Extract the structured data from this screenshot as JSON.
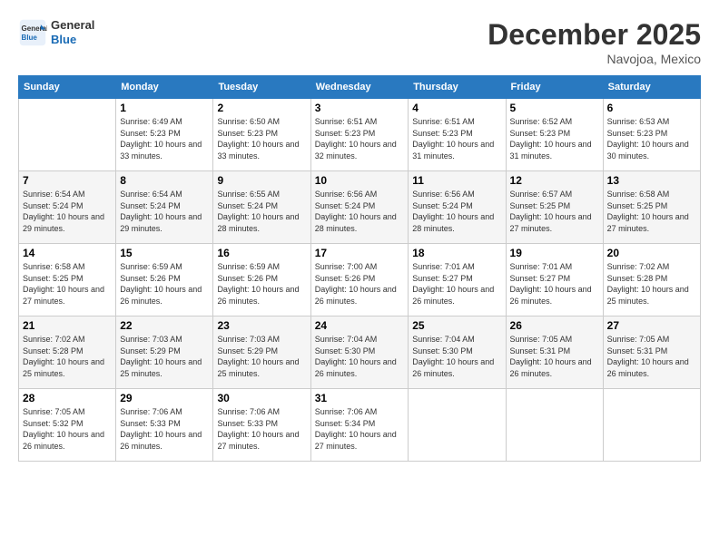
{
  "header": {
    "logo_line1": "General",
    "logo_line2": "Blue",
    "month": "December 2025",
    "location": "Navojoa, Mexico"
  },
  "days_of_week": [
    "Sunday",
    "Monday",
    "Tuesday",
    "Wednesday",
    "Thursday",
    "Friday",
    "Saturday"
  ],
  "weeks": [
    [
      {
        "day": "",
        "info": ""
      },
      {
        "day": "1",
        "info": "Sunrise: 6:49 AM\nSunset: 5:23 PM\nDaylight: 10 hours\nand 33 minutes."
      },
      {
        "day": "2",
        "info": "Sunrise: 6:50 AM\nSunset: 5:23 PM\nDaylight: 10 hours\nand 33 minutes."
      },
      {
        "day": "3",
        "info": "Sunrise: 6:51 AM\nSunset: 5:23 PM\nDaylight: 10 hours\nand 32 minutes."
      },
      {
        "day": "4",
        "info": "Sunrise: 6:51 AM\nSunset: 5:23 PM\nDaylight: 10 hours\nand 31 minutes."
      },
      {
        "day": "5",
        "info": "Sunrise: 6:52 AM\nSunset: 5:23 PM\nDaylight: 10 hours\nand 31 minutes."
      },
      {
        "day": "6",
        "info": "Sunrise: 6:53 AM\nSunset: 5:23 PM\nDaylight: 10 hours\nand 30 minutes."
      }
    ],
    [
      {
        "day": "7",
        "info": "Sunrise: 6:54 AM\nSunset: 5:24 PM\nDaylight: 10 hours\nand 29 minutes."
      },
      {
        "day": "8",
        "info": "Sunrise: 6:54 AM\nSunset: 5:24 PM\nDaylight: 10 hours\nand 29 minutes."
      },
      {
        "day": "9",
        "info": "Sunrise: 6:55 AM\nSunset: 5:24 PM\nDaylight: 10 hours\nand 28 minutes."
      },
      {
        "day": "10",
        "info": "Sunrise: 6:56 AM\nSunset: 5:24 PM\nDaylight: 10 hours\nand 28 minutes."
      },
      {
        "day": "11",
        "info": "Sunrise: 6:56 AM\nSunset: 5:24 PM\nDaylight: 10 hours\nand 28 minutes."
      },
      {
        "day": "12",
        "info": "Sunrise: 6:57 AM\nSunset: 5:25 PM\nDaylight: 10 hours\nand 27 minutes."
      },
      {
        "day": "13",
        "info": "Sunrise: 6:58 AM\nSunset: 5:25 PM\nDaylight: 10 hours\nand 27 minutes."
      }
    ],
    [
      {
        "day": "14",
        "info": "Sunrise: 6:58 AM\nSunset: 5:25 PM\nDaylight: 10 hours\nand 27 minutes."
      },
      {
        "day": "15",
        "info": "Sunrise: 6:59 AM\nSunset: 5:26 PM\nDaylight: 10 hours\nand 26 minutes."
      },
      {
        "day": "16",
        "info": "Sunrise: 6:59 AM\nSunset: 5:26 PM\nDaylight: 10 hours\nand 26 minutes."
      },
      {
        "day": "17",
        "info": "Sunrise: 7:00 AM\nSunset: 5:26 PM\nDaylight: 10 hours\nand 26 minutes."
      },
      {
        "day": "18",
        "info": "Sunrise: 7:01 AM\nSunset: 5:27 PM\nDaylight: 10 hours\nand 26 minutes."
      },
      {
        "day": "19",
        "info": "Sunrise: 7:01 AM\nSunset: 5:27 PM\nDaylight: 10 hours\nand 26 minutes."
      },
      {
        "day": "20",
        "info": "Sunrise: 7:02 AM\nSunset: 5:28 PM\nDaylight: 10 hours\nand 25 minutes."
      }
    ],
    [
      {
        "day": "21",
        "info": "Sunrise: 7:02 AM\nSunset: 5:28 PM\nDaylight: 10 hours\nand 25 minutes."
      },
      {
        "day": "22",
        "info": "Sunrise: 7:03 AM\nSunset: 5:29 PM\nDaylight: 10 hours\nand 25 minutes."
      },
      {
        "day": "23",
        "info": "Sunrise: 7:03 AM\nSunset: 5:29 PM\nDaylight: 10 hours\nand 25 minutes."
      },
      {
        "day": "24",
        "info": "Sunrise: 7:04 AM\nSunset: 5:30 PM\nDaylight: 10 hours\nand 26 minutes."
      },
      {
        "day": "25",
        "info": "Sunrise: 7:04 AM\nSunset: 5:30 PM\nDaylight: 10 hours\nand 26 minutes."
      },
      {
        "day": "26",
        "info": "Sunrise: 7:05 AM\nSunset: 5:31 PM\nDaylight: 10 hours\nand 26 minutes."
      },
      {
        "day": "27",
        "info": "Sunrise: 7:05 AM\nSunset: 5:31 PM\nDaylight: 10 hours\nand 26 minutes."
      }
    ],
    [
      {
        "day": "28",
        "info": "Sunrise: 7:05 AM\nSunset: 5:32 PM\nDaylight: 10 hours\nand 26 minutes."
      },
      {
        "day": "29",
        "info": "Sunrise: 7:06 AM\nSunset: 5:33 PM\nDaylight: 10 hours\nand 26 minutes."
      },
      {
        "day": "30",
        "info": "Sunrise: 7:06 AM\nSunset: 5:33 PM\nDaylight: 10 hours\nand 27 minutes."
      },
      {
        "day": "31",
        "info": "Sunrise: 7:06 AM\nSunset: 5:34 PM\nDaylight: 10 hours\nand 27 minutes."
      },
      {
        "day": "",
        "info": ""
      },
      {
        "day": "",
        "info": ""
      },
      {
        "day": "",
        "info": ""
      }
    ]
  ]
}
